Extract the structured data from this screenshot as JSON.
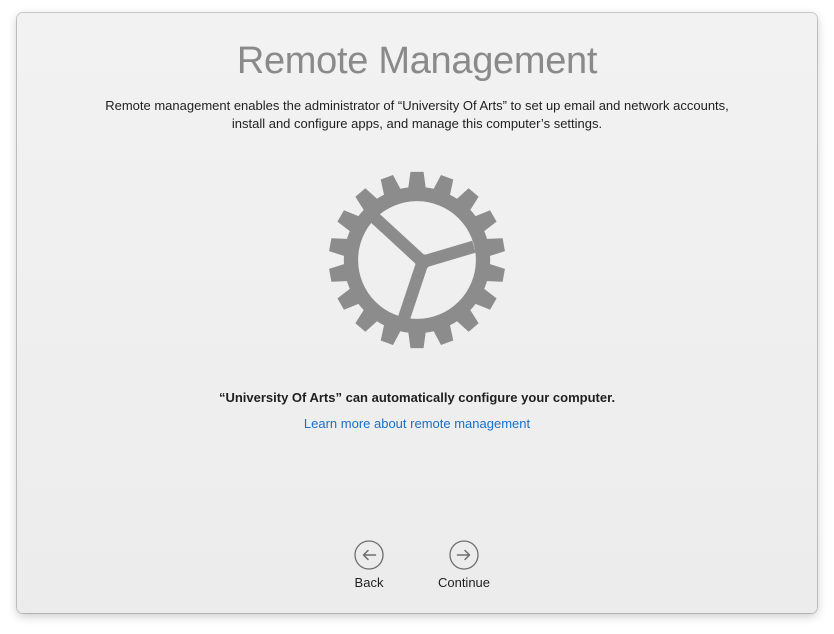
{
  "page": {
    "title": "Remote Management",
    "description": "Remote management enables the administrator of “University Of Arts” to set up email and network accounts, install and configure apps, and manage this computer’s settings.",
    "statement": "“University Of Arts” can automatically configure your computer.",
    "learn_more": "Learn more about remote management",
    "icon": "gear-icon"
  },
  "nav": {
    "back_label": "Back",
    "back_icon": "arrow-left-circle-icon",
    "continue_label": "Continue",
    "continue_icon": "arrow-right-circle-icon"
  },
  "colors": {
    "title": "#8a8a8a",
    "gear": "#8c8c8c",
    "link": "#1a6fc9",
    "background": "#efefef"
  }
}
